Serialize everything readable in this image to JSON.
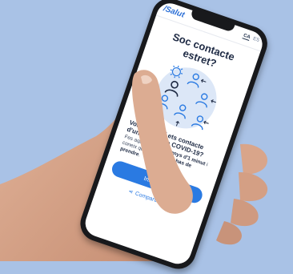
{
  "header": {
    "logo_text": "/Salut",
    "languages": [
      "CA",
      "ES"
    ]
  },
  "main": {
    "title_line1": "Soc contacte",
    "title_line2": "estret?",
    "question": "Vols saber si ets contacte d'un positiu de COVID-19?",
    "body_prefix": "Fes aquest test en ",
    "body_bold1": "menys d'1 minut",
    "body_middle": " i coneix quines ",
    "body_bold2": "mesures has de prendre",
    "body_suffix": ".",
    "start_button": "Iniciar test",
    "share_link": "Compartir el test"
  },
  "colors": {
    "background": "#a9c2e6",
    "accent": "#2a7ae2",
    "heading": "#1e2a44"
  },
  "icons": [
    "share-icon",
    "virus-icon",
    "person-icon",
    "arrow-icon"
  ]
}
